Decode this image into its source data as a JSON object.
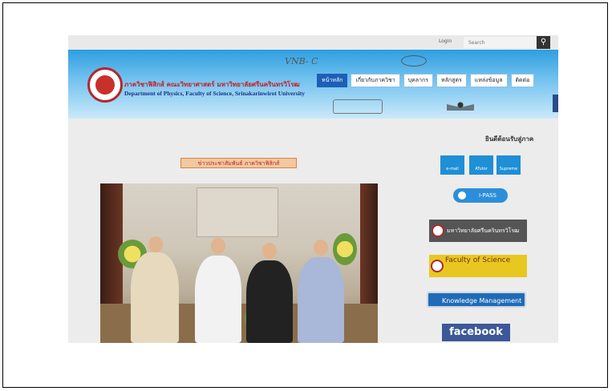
{
  "topbar": {
    "login_label": "Login",
    "search_placeholder": "Search"
  },
  "header": {
    "thai_title": "ภาควิชาฟิสิกส์ คณะวิทยาศาสตร์ มหาวิทยาลัยศรีนครินทรวิโรฒ",
    "english_title": "Department of Physics, Faculty of Science, Srinakarinwirot University",
    "decor_text": "VNB- C"
  },
  "nav": {
    "items": [
      "หน้าหลัก",
      "เกี่ยวกับภาควิชา",
      "บุคลากร",
      "หลักสูตร",
      "แหล่งข้อมูล",
      "ติดต่อ"
    ]
  },
  "welcome_text": "ยินดีต้อนรับสู่ภาค",
  "news_banner": "ข่าวประชาสัมพันธ์ ภาควิชาฟิสิกส์",
  "services": {
    "email": "e-mail",
    "atutor": "ATutor",
    "supreme": "Supreme",
    "ipass": "I-PASS"
  },
  "links": {
    "swu": "มหาวิทยาลัยศรีนครินทรวิโรฒ",
    "fos": "Faculty of Science",
    "km": "Knowledge Management",
    "facebook": "facebook"
  },
  "colors": {
    "nav_active": "#1d5fb7",
    "banner": "#2e9ee0",
    "facebook": "#3b5998"
  }
}
